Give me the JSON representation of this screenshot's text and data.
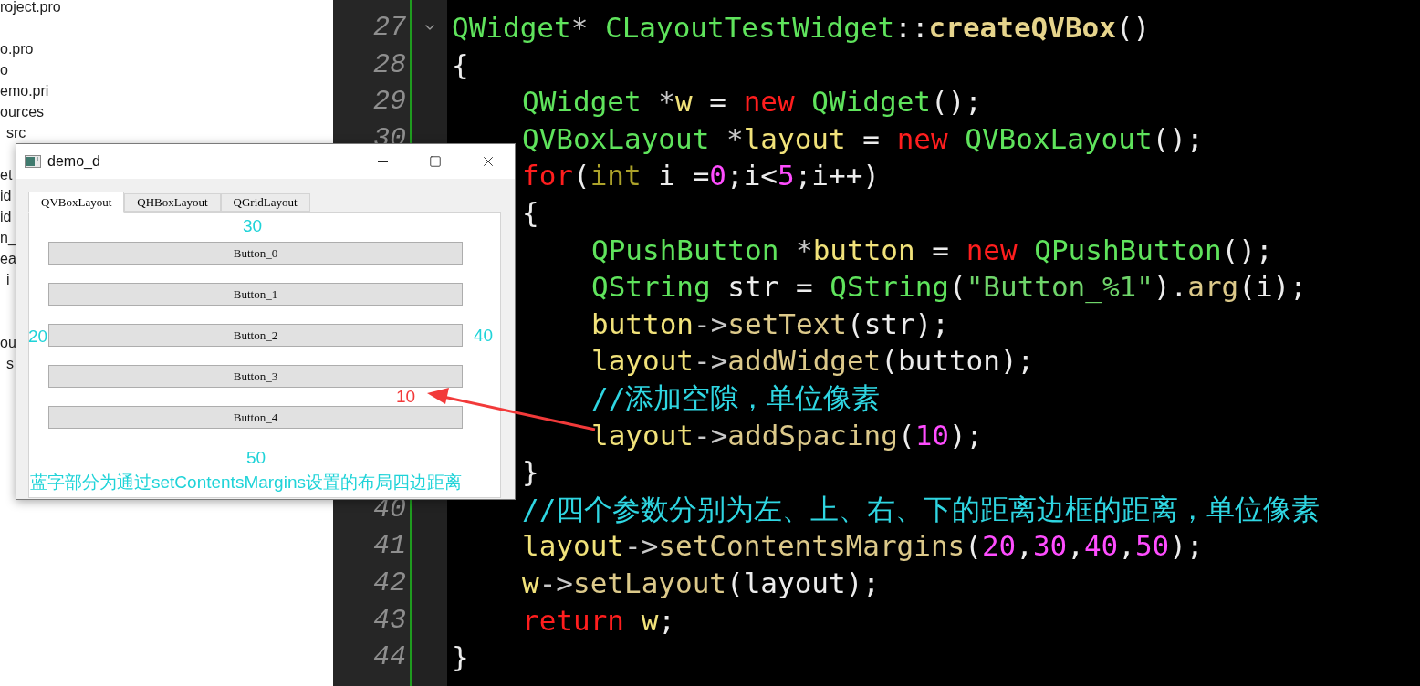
{
  "project_tree": [
    {
      "label": "roject.pro"
    },
    {
      "label": "o.pro"
    },
    {
      "label": "o"
    },
    {
      "label": "emo.pri"
    },
    {
      "label": "ources",
      "children": [
        {
          "label": "src"
        }
      ]
    },
    {
      "label": "et"
    },
    {
      "label": "id"
    },
    {
      "label": "id"
    },
    {
      "label": "n_"
    },
    {
      "label": "ea",
      "children": [
        {
          "label": "i"
        }
      ]
    },
    {
      "label": "ou",
      "children": [
        {
          "label": "s"
        }
      ]
    }
  ],
  "editor": {
    "lines": [
      {
        "number": "27",
        "folded": false,
        "tokens": [
          {
            "kind": "type",
            "text": "QWidget"
          },
          {
            "kind": "op",
            "text": "* "
          },
          {
            "kind": "type",
            "text": "CLayoutTestWidget"
          },
          {
            "kind": "plain",
            "text": "::"
          },
          {
            "kind": "decl",
            "text": "createQVBox"
          },
          {
            "kind": "plain",
            "text": "()"
          }
        ]
      },
      {
        "number": "28",
        "tokens": [
          {
            "kind": "plain",
            "text": "{"
          }
        ]
      },
      {
        "children": [
          {
            "number": "29",
            "tokens": [
              {
                "kind": "type",
                "text": "QWidget"
              },
              {
                "kind": "op",
                "text": " *"
              },
              {
                "kind": "var",
                "text": "w"
              },
              {
                "kind": "plain",
                "text": " = "
              },
              {
                "kind": "keyword",
                "text": "new"
              },
              {
                "kind": "type",
                "text": " QWidget"
              },
              {
                "kind": "plain",
                "text": "();"
              }
            ]
          },
          {
            "number": "30",
            "tokens": [
              {
                "kind": "type",
                "text": "QVBoxLayout"
              },
              {
                "kind": "op",
                "text": " *"
              },
              {
                "kind": "var",
                "text": "layout"
              },
              {
                "kind": "plain",
                "text": " = "
              },
              {
                "kind": "keyword",
                "text": "new"
              },
              {
                "kind": "type",
                "text": " QVBoxLayout"
              },
              {
                "kind": "plain",
                "text": "();"
              }
            ]
          },
          {
            "tokens": [
              {
                "kind": "keyword",
                "text": "for"
              },
              {
                "kind": "plain",
                "text": "("
              },
              {
                "kind": "int",
                "text": "int"
              },
              {
                "kind": "plain",
                "text": " i ="
              },
              {
                "kind": "number",
                "text": "0"
              },
              {
                "kind": "plain",
                "text": ";i<"
              },
              {
                "kind": "number",
                "text": "5"
              },
              {
                "kind": "plain",
                "text": ";i++)"
              }
            ]
          },
          {
            "tokens": [
              {
                "kind": "plain",
                "text": "{"
              }
            ]
          },
          {
            "children": [
              {
                "tokens": [
                  {
                    "kind": "type",
                    "text": "QPushButton"
                  },
                  {
                    "kind": "op",
                    "text": " *"
                  },
                  {
                    "kind": "var",
                    "text": "button"
                  },
                  {
                    "kind": "plain",
                    "text": " = "
                  },
                  {
                    "kind": "keyword",
                    "text": "new"
                  },
                  {
                    "kind": "type",
                    "text": " QPushButton"
                  },
                  {
                    "kind": "plain",
                    "text": "();"
                  }
                ]
              },
              {
                "tokens": [
                  {
                    "kind": "type",
                    "text": "QString"
                  },
                  {
                    "kind": "plain",
                    "text": " str = "
                  },
                  {
                    "kind": "type",
                    "text": "QString"
                  },
                  {
                    "kind": "plain",
                    "text": "("
                  },
                  {
                    "kind": "string",
                    "text": "\"Button_%1\""
                  },
                  {
                    "kind": "plain",
                    "text": ")."
                  },
                  {
                    "kind": "func",
                    "text": "arg"
                  },
                  {
                    "kind": "plain",
                    "text": "(i);"
                  }
                ]
              },
              {
                "tokens": [
                  {
                    "kind": "var",
                    "text": "button"
                  },
                  {
                    "kind": "op",
                    "text": "->"
                  },
                  {
                    "kind": "func",
                    "text": "setText"
                  },
                  {
                    "kind": "plain",
                    "text": "(str);"
                  }
                ]
              },
              {
                "tokens": [
                  {
                    "kind": "var",
                    "text": "layout"
                  },
                  {
                    "kind": "op",
                    "text": "->"
                  },
                  {
                    "kind": "func",
                    "text": "addWidget"
                  },
                  {
                    "kind": "plain",
                    "text": "(button);"
                  }
                ]
              },
              {
                "tokens": [
                  {
                    "kind": "comment",
                    "text": "//添加空隙，单位像素"
                  }
                ]
              },
              {
                "tokens": [
                  {
                    "kind": "var",
                    "text": "layout"
                  },
                  {
                    "kind": "op",
                    "text": "->"
                  },
                  {
                    "kind": "func",
                    "text": "addSpacing"
                  },
                  {
                    "kind": "plain",
                    "text": "("
                  },
                  {
                    "kind": "number",
                    "text": "10"
                  },
                  {
                    "kind": "plain",
                    "text": ");"
                  }
                ]
              }
            ]
          },
          {
            "tokens": [
              {
                "kind": "plain",
                "text": "}"
              }
            ]
          },
          {
            "number": "40",
            "tokens": [
              {
                "kind": "comment",
                "text": "//四个参数分别为左、上、右、下的距离边框的距离，单位像素"
              }
            ]
          },
          {
            "number": "41",
            "tokens": [
              {
                "kind": "var",
                "text": "layout"
              },
              {
                "kind": "op",
                "text": "->"
              },
              {
                "kind": "func",
                "text": "setContentsMargins"
              },
              {
                "kind": "plain",
                "text": "("
              },
              {
                "kind": "number",
                "text": "20"
              },
              {
                "kind": "plain",
                "text": ","
              },
              {
                "kind": "number",
                "text": "30"
              },
              {
                "kind": "plain",
                "text": ","
              },
              {
                "kind": "number",
                "text": "40"
              },
              {
                "kind": "plain",
                "text": ","
              },
              {
                "kind": "number",
                "text": "50"
              },
              {
                "kind": "plain",
                "text": ");"
              }
            ]
          },
          {
            "number": "42",
            "tokens": [
              {
                "kind": "var",
                "text": "w"
              },
              {
                "kind": "op",
                "text": "->"
              },
              {
                "kind": "func",
                "text": "setLayout"
              },
              {
                "kind": "plain",
                "text": "(layout);"
              }
            ]
          },
          {
            "number": "43",
            "tokens": [
              {
                "kind": "keyword",
                "text": "return"
              },
              {
                "kind": "var",
                "text": " w"
              },
              {
                "kind": "plain",
                "text": ";"
              }
            ]
          }
        ]
      },
      {
        "number": "44",
        "tokens": [
          {
            "kind": "plain",
            "text": "}"
          }
        ]
      }
    ]
  },
  "window": {
    "title": "demo_d",
    "tabs": [
      {
        "label": "QVBoxLayout",
        "selected": true
      },
      {
        "label": "QHBoxLayout",
        "selected": false
      },
      {
        "label": "QGridLayout",
        "selected": false
      }
    ],
    "buttons": [
      "Button_0",
      "Button_1",
      "Button_2",
      "Button_3",
      "Button_4"
    ],
    "annotations": [
      {
        "kind": "top",
        "text": "30"
      },
      {
        "kind": "left",
        "text": "20"
      },
      {
        "kind": "right",
        "text": "40"
      },
      {
        "kind": "spacing",
        "text": "10"
      },
      {
        "kind": "bottom",
        "text": "50"
      }
    ],
    "caption": "蓝字部分为通过setContentsMargins设置的布局四边距离"
  }
}
